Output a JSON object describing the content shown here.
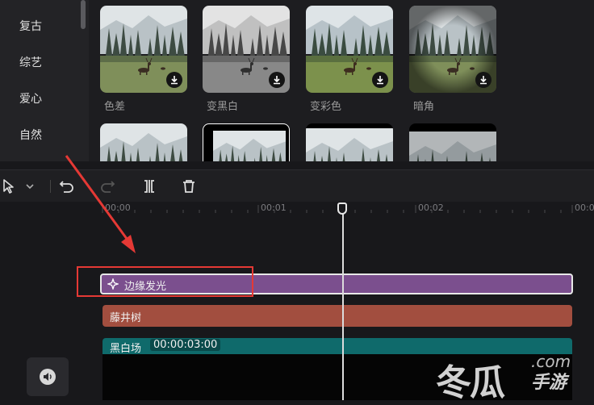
{
  "sidebar": {
    "categories": [
      "复古",
      "综艺",
      "爱心",
      "自然"
    ]
  },
  "effects": [
    {
      "label": "色差"
    },
    {
      "label": "变黑白"
    },
    {
      "label": "变彩色"
    },
    {
      "label": "暗角"
    },
    {
      "label": ""
    },
    {
      "label": ""
    },
    {
      "label": ""
    },
    {
      "label": ""
    }
  ],
  "ruler": {
    "ticks": [
      "00:00",
      "00:01",
      "00:02",
      "00:0"
    ]
  },
  "tracks": {
    "effect_clip": "边缘发光",
    "filter_clip": "藤井树",
    "video_clip_name": "黑白场",
    "video_clip_duration": "00:00:03:00"
  },
  "watermark": {
    "text": "冬瓜",
    "domain": ".com",
    "sub": "手游"
  },
  "colors": {
    "effect_clip": "#7b4f8e",
    "filter_clip": "#a24e3f",
    "video_clip": "#0f6a6b",
    "highlight": "#e53935"
  }
}
